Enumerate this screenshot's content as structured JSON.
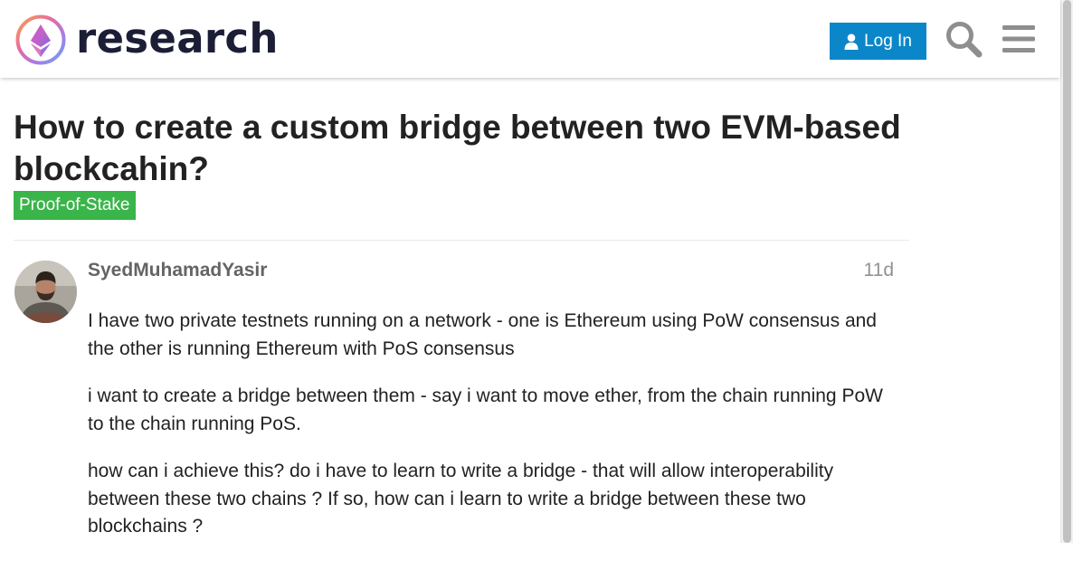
{
  "header": {
    "site_name": "research",
    "login_label": "Log In",
    "login_icon": "user-icon",
    "search_icon": "search-icon",
    "menu_icon": "hamburger-menu-icon"
  },
  "topic": {
    "title": "How to create a custom bridge between two EVM-based blockcahin?",
    "category": "Proof-of-Stake",
    "category_color": "#3ab54a"
  },
  "post": {
    "author": "SyedMuhamadYasir",
    "date": "11d",
    "paragraphs": [
      "I have two private testnets running on a network - one is Ethereum using PoW consensus and the other is running Ethereum with PoS consensus",
      "i want to create a bridge between them - say i want to move ether, from the chain running PoW to the chain running PoS.",
      "how can i achieve this? do i have to learn to write a bridge - that will allow interoperability between these two chains ? If so, how can i learn to write a bridge between these two blockchains ?"
    ]
  },
  "colors": {
    "accent": "#0b87c9",
    "brand_text": "#1c1e36",
    "muted_text": "#646464",
    "date_text": "#919191"
  }
}
